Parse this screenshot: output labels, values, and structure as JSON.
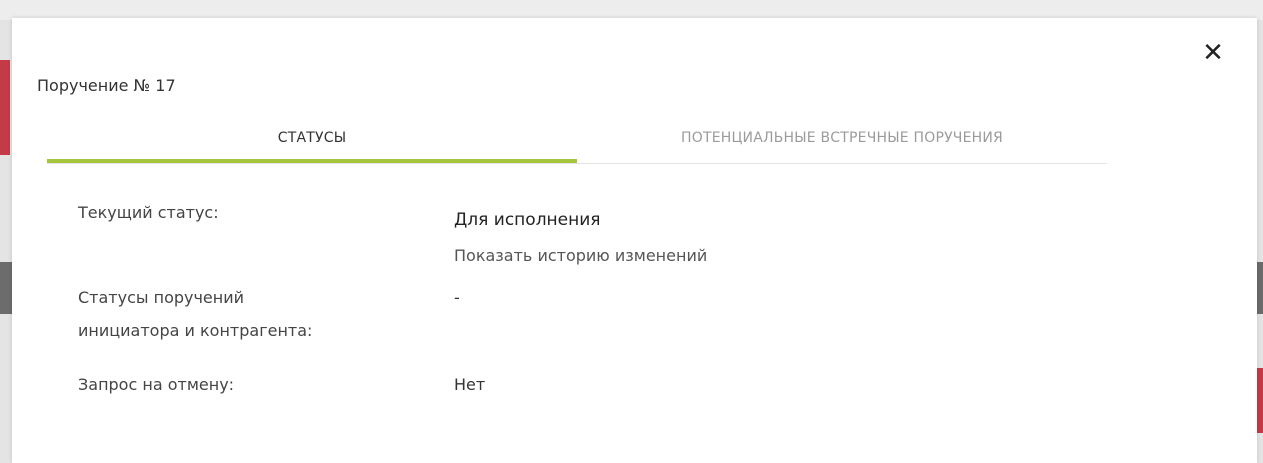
{
  "dialog": {
    "title": "Поручение № 17",
    "close_icon": "close-icon",
    "tabs": [
      {
        "label": "СТАТУСЫ",
        "active": true
      },
      {
        "label": "ПОТЕНЦИАЛЬНЫЕ ВСТРЕЧНЫЕ ПОРУЧЕНИЯ",
        "active": false
      }
    ],
    "fields": {
      "current_status_label": "Текущий статус:",
      "current_status_value": "Для исполнения",
      "history_link": "Показать историю изменений",
      "counterparty_label_line1": "Статусы поручений",
      "counterparty_label_line2": "инициатора и контрагента:",
      "counterparty_value": "-",
      "cancel_request_label": "Запрос на отмену:",
      "cancel_request_value": "Нет"
    }
  },
  "colors": {
    "active_tab_underline": "#a6c53c",
    "background_accent": "#c23b47"
  }
}
